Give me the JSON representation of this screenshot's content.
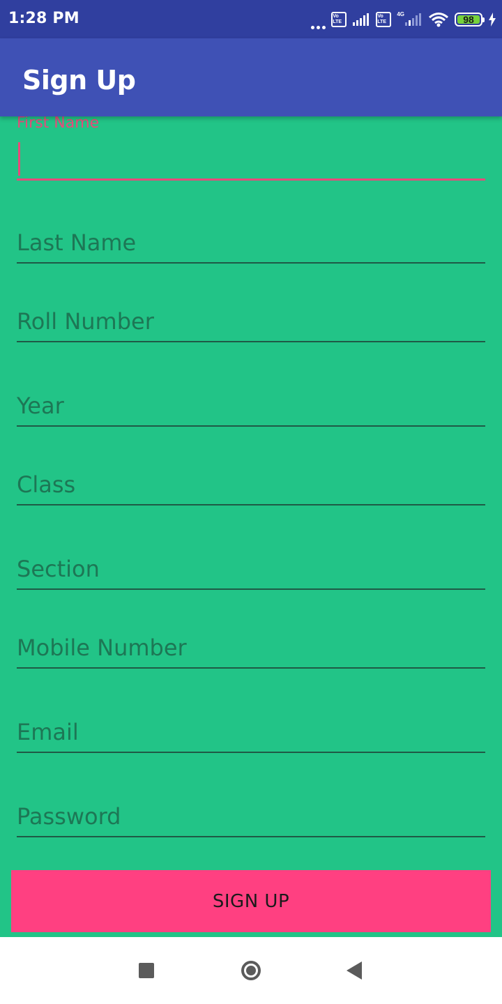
{
  "status_bar": {
    "time": "1:28 PM",
    "volte_1": "Vo LTE",
    "volte_2": "Vo LTE",
    "network_type": "4G",
    "battery_level": "98",
    "icons": [
      "more-dots-icon",
      "volte-icon",
      "signal-icon",
      "volte-icon",
      "signal-4g-icon",
      "wifi-icon",
      "battery-icon",
      "charging-bolt-icon"
    ]
  },
  "app_bar": {
    "title": "Sign Up"
  },
  "form": {
    "first_name": {
      "label": "First Name",
      "value": ""
    },
    "last_name": {
      "placeholder": "Last Name"
    },
    "roll_number": {
      "placeholder": "Roll Number"
    },
    "year": {
      "placeholder": "Year"
    },
    "class": {
      "placeholder": "Class"
    },
    "section": {
      "placeholder": "Section"
    },
    "mobile_number": {
      "placeholder": "Mobile Number"
    },
    "email": {
      "placeholder": "Email"
    },
    "password": {
      "placeholder": "Password"
    },
    "submit_label": "SIGN UP"
  },
  "colors": {
    "status_bar": "#303f9f",
    "app_bar": "#3f51b5",
    "background": "#22c487",
    "accent": "#ff4081",
    "focused_field": "#e84a7b"
  },
  "nav_bar": {
    "icons": [
      "recents-square-icon",
      "home-circle-icon",
      "back-triangle-icon"
    ]
  }
}
